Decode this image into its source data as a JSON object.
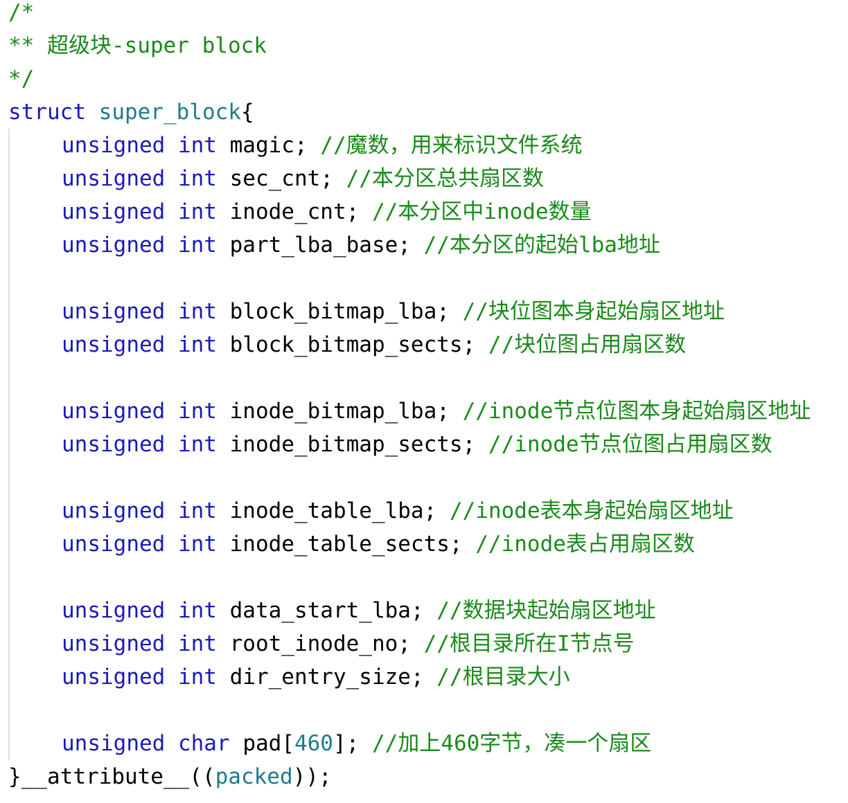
{
  "colors": {
    "comment": "#1a8a1a",
    "keyword": "#1a1ab8",
    "type_name": "#1f7a8c",
    "number": "#1f7a8c",
    "text": "#000000",
    "indent_guide": "#dcdcdc"
  },
  "header": {
    "open": "/*",
    "title": "** 超级块-super block",
    "close": "*/"
  },
  "struct": {
    "keyword": "struct",
    "name": "super_block",
    "open_brace": "{",
    "fields": [
      {
        "type": "unsigned int",
        "name": "magic",
        "comment": "//魔数，用来标识文件系统"
      },
      {
        "type": "unsigned int",
        "name": "sec_cnt",
        "comment": "//本分区总共扇区数"
      },
      {
        "type": "unsigned int",
        "name": "inode_cnt",
        "comment": "//本分区中inode数量"
      },
      {
        "type": "unsigned int",
        "name": "part_lba_base",
        "comment": "//本分区的起始lba地址"
      },
      {
        "type": "unsigned int",
        "name": "block_bitmap_lba",
        "comment": "//块位图本身起始扇区地址"
      },
      {
        "type": "unsigned int",
        "name": "block_bitmap_sects",
        "comment": "//块位图占用扇区数"
      },
      {
        "type": "unsigned int",
        "name": "inode_bitmap_lba",
        "comment": "//inode节点位图本身起始扇区地址"
      },
      {
        "type": "unsigned int",
        "name": "inode_bitmap_sects",
        "comment": "//inode节点位图占用扇区数"
      },
      {
        "type": "unsigned int",
        "name": "inode_table_lba",
        "comment": "//inode表本身起始扇区地址"
      },
      {
        "type": "unsigned int",
        "name": "inode_table_sects",
        "comment": "//inode表占用扇区数"
      },
      {
        "type": "unsigned int",
        "name": "data_start_lba",
        "comment": "//数据块起始扇区地址"
      },
      {
        "type": "unsigned int",
        "name": "root_inode_no",
        "comment": "//根目录所在I节点号"
      },
      {
        "type": "unsigned int",
        "name": "dir_entry_size",
        "comment": "//根目录大小"
      }
    ],
    "pad": {
      "type": "unsigned char",
      "name": "pad",
      "size": "460",
      "comment": "//加上460字节，凑一个扇区"
    },
    "close_brace": "}",
    "attribute_prefix": "__attribute__((",
    "attribute_value": "packed",
    "attribute_suffix": "));"
  }
}
